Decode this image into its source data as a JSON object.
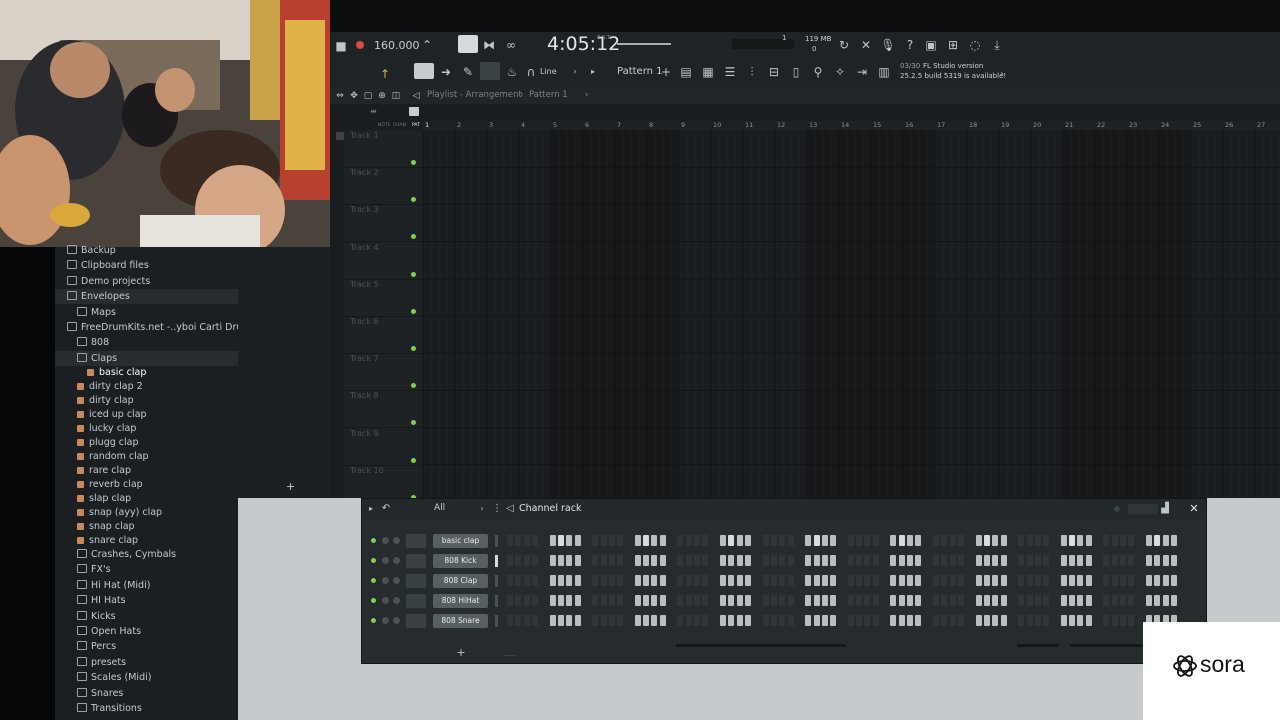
{
  "toolbar": {
    "tempo": "160.000",
    "time": "4:05:12",
    "time_label": "B:S:T",
    "cpu": "1",
    "memory": "119 MB",
    "memory_sub": "0",
    "snap_label": "Line",
    "pattern_label": "Pattern 1",
    "news_date": "03/30",
    "news_line1": "FL Studio version",
    "news_line2": "25.2.5 build 5319 is available!",
    "icons": [
      "stop-icon",
      "record-icon",
      "metronome-icon",
      "step-edit-icon",
      "blend-icon",
      "wait-input-icon",
      "loop-record-icon",
      "typing-keyboard-icon",
      "play-icon",
      "draw-icon",
      "paint-icon",
      "snap-magnet-icon",
      "mixer-icon",
      "piano-roll-icon",
      "channel-rack-icon",
      "plugin-picker-icon",
      "browser-icon",
      "help-icon",
      "save-icon",
      "export-icon",
      "download-icon"
    ]
  },
  "playlist": {
    "breadcrumb": "Playlist - Arrangement",
    "breadcrumb_pattern": "Pattern 1",
    "ruler": [
      "1",
      "2",
      "3",
      "4",
      "5",
      "6",
      "7",
      "8",
      "9",
      "10",
      "11",
      "12",
      "13",
      "14",
      "15",
      "16",
      "17",
      "18",
      "19",
      "20",
      "21",
      "22",
      "23",
      "24",
      "25",
      "26",
      "27"
    ],
    "col_headers": [
      "NOTE",
      "CHAN",
      "PAT"
    ],
    "tracks": [
      "Track 1",
      "Track 2",
      "Track 3",
      "Track 4",
      "Track 5",
      "Track 6",
      "Track 7",
      "Track 8",
      "Track 9",
      "Track 10"
    ]
  },
  "browser": {
    "items": [
      {
        "label": "Backup",
        "type": "folder",
        "indent": 0
      },
      {
        "label": "Clipboard files",
        "type": "folder",
        "indent": 0
      },
      {
        "label": "Demo projects",
        "type": "folder",
        "indent": 0
      },
      {
        "label": "Envelopes",
        "type": "folder",
        "indent": 0,
        "selected": true
      },
      {
        "label": "Maps",
        "type": "folder",
        "indent": 1
      },
      {
        "label": "FreeDrumKits.net -..yboi Carti Drum Kit",
        "type": "folder",
        "indent": 0
      },
      {
        "label": "808",
        "type": "folder",
        "indent": 1
      },
      {
        "label": "Claps",
        "type": "folder",
        "indent": 1,
        "selected": true
      },
      {
        "label": "basic clap",
        "type": "sample",
        "indent": 2,
        "highlight": true
      },
      {
        "label": "dirty clap 2",
        "type": "sample",
        "indent": 1
      },
      {
        "label": "dirty clap",
        "type": "sample",
        "indent": 1
      },
      {
        "label": "iced up clap",
        "type": "sample",
        "indent": 1
      },
      {
        "label": "lucky clap",
        "type": "sample",
        "indent": 1
      },
      {
        "label": "plugg clap",
        "type": "sample",
        "indent": 1
      },
      {
        "label": "random clap",
        "type": "sample",
        "indent": 1
      },
      {
        "label": "rare clap",
        "type": "sample",
        "indent": 1
      },
      {
        "label": "reverb clap",
        "type": "sample",
        "indent": 1
      },
      {
        "label": "slap clap",
        "type": "sample",
        "indent": 1
      },
      {
        "label": "snap (ayy) clap",
        "type": "sample",
        "indent": 1
      },
      {
        "label": "snap clap",
        "type": "sample",
        "indent": 1
      },
      {
        "label": "snare clap",
        "type": "sample",
        "indent": 1
      },
      {
        "label": "Crashes, Cymbals",
        "type": "folder",
        "indent": 1
      },
      {
        "label": "FX's",
        "type": "folder",
        "indent": 1
      },
      {
        "label": "Hi Hat (Midi)",
        "type": "folder",
        "indent": 1
      },
      {
        "label": "HI Hats",
        "type": "folder",
        "indent": 1
      },
      {
        "label": "Kicks",
        "type": "folder",
        "indent": 1
      },
      {
        "label": "Open Hats",
        "type": "folder",
        "indent": 1
      },
      {
        "label": "Percs",
        "type": "folder",
        "indent": 1
      },
      {
        "label": "presets",
        "type": "folder",
        "indent": 1
      },
      {
        "label": "Scales (Midi)",
        "type": "folder",
        "indent": 1
      },
      {
        "label": "Snares",
        "type": "folder",
        "indent": 1
      },
      {
        "label": "Transitions",
        "type": "folder",
        "indent": 1
      }
    ]
  },
  "channel_rack": {
    "title": "Channel rack",
    "filter": "All",
    "channels": [
      {
        "name": "basic clap",
        "steps": "0000000000000000"
      },
      {
        "name": "808 Kick",
        "steps": "0000000000000000"
      },
      {
        "name": "808 Clap",
        "steps": "0000000000000000"
      },
      {
        "name": "808 HiHat",
        "steps": "0000000000000000"
      },
      {
        "name": "808 Snare",
        "steps": "0000000000000000"
      }
    ]
  },
  "watermark": {
    "brand": "sora"
  }
}
